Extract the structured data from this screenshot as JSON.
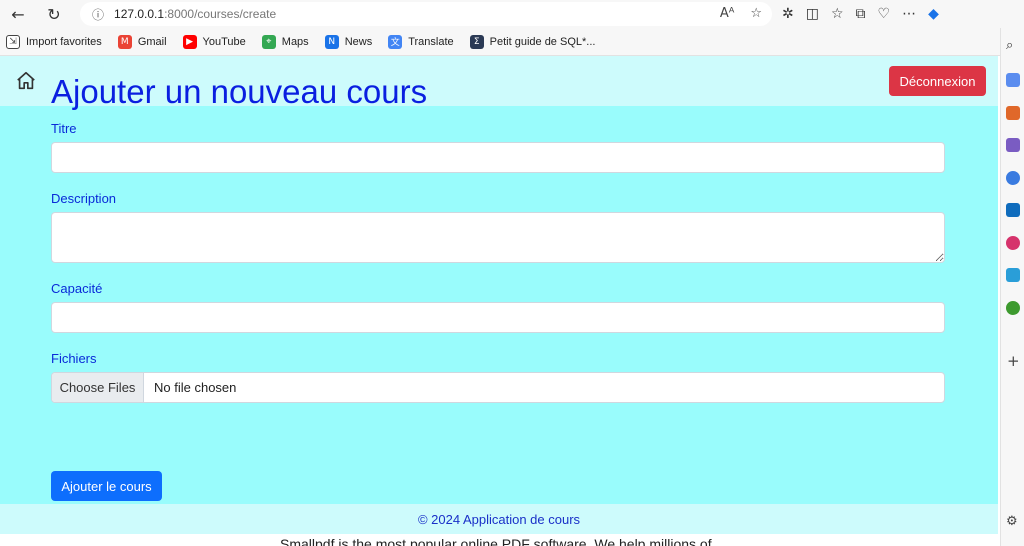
{
  "browser": {
    "url_host": "127.0.0.1",
    "url_path": ":8000/courses/create",
    "bookmarks": [
      {
        "label": "Import favorites",
        "icon": "import-icon",
        "color": "#444444"
      },
      {
        "label": "Gmail",
        "icon": "gmail-icon",
        "color": "#ea4335"
      },
      {
        "label": "YouTube",
        "icon": "youtube-icon",
        "color": "#ff0000"
      },
      {
        "label": "Maps",
        "icon": "maps-icon",
        "color": "#34a853"
      },
      {
        "label": "News",
        "icon": "news-icon",
        "color": "#1a73e8"
      },
      {
        "label": "Translate",
        "icon": "translate-icon",
        "color": "#4285f4"
      },
      {
        "label": "Petit guide de SQL*...",
        "icon": "sql-guide-icon",
        "color": "#2b3a55"
      }
    ]
  },
  "navbar": {
    "logout_label": "Déconnexion"
  },
  "form": {
    "heading": "Ajouter un nouveau cours",
    "title_label": "Titre",
    "title_value": "",
    "description_label": "Description",
    "description_value": "",
    "capacity_label": "Capacité",
    "capacity_value": "",
    "files_label": "Fichiers",
    "file_button_label": "Choose Files",
    "file_status": "No file chosen",
    "submit_label": "Ajouter le cours"
  },
  "footer": {
    "text": "© 2024 Application de cours"
  },
  "underlying_text": "Smallpdf is the most popular online PDF software. We help millions of",
  "colors": {
    "page_bg": "#99fcfc",
    "navbar_bg": "#cdfbfc",
    "danger": "#dc3545",
    "primary": "#0d6efd",
    "heading": "#0a1fe0"
  }
}
